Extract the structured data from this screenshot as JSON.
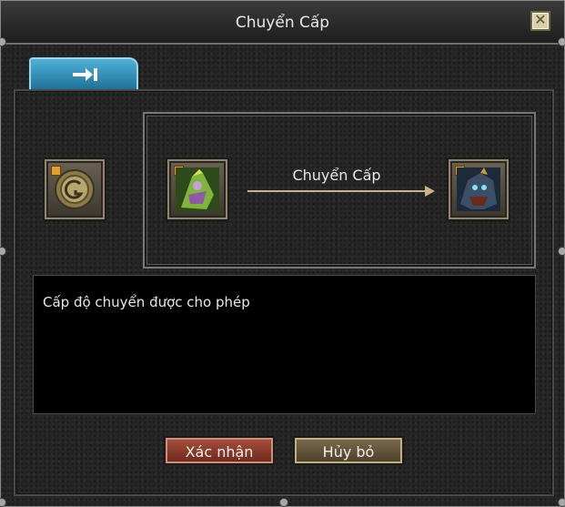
{
  "window": {
    "title": "Chuyển Cấp",
    "close_symbol": "✕"
  },
  "tab": {
    "icon": "arrow-to-bar-icon"
  },
  "slots": {
    "material": {
      "icon": "rune-coin-icon"
    },
    "source": {
      "icon": "green-warrior-icon"
    },
    "result": {
      "icon": "dark-monster-icon"
    }
  },
  "transfer": {
    "label": "Chuyển Cấp"
  },
  "description": {
    "text": "Cấp độ chuyển được cho phép"
  },
  "buttons": {
    "confirm_label": "Xác nhận",
    "cancel_label": "Hủy bỏ"
  },
  "colors": {
    "tab": "#1f6f98",
    "confirm": "#8f3a2a",
    "cancel": "#6a5a3e",
    "arrow": "#c8b48a"
  }
}
